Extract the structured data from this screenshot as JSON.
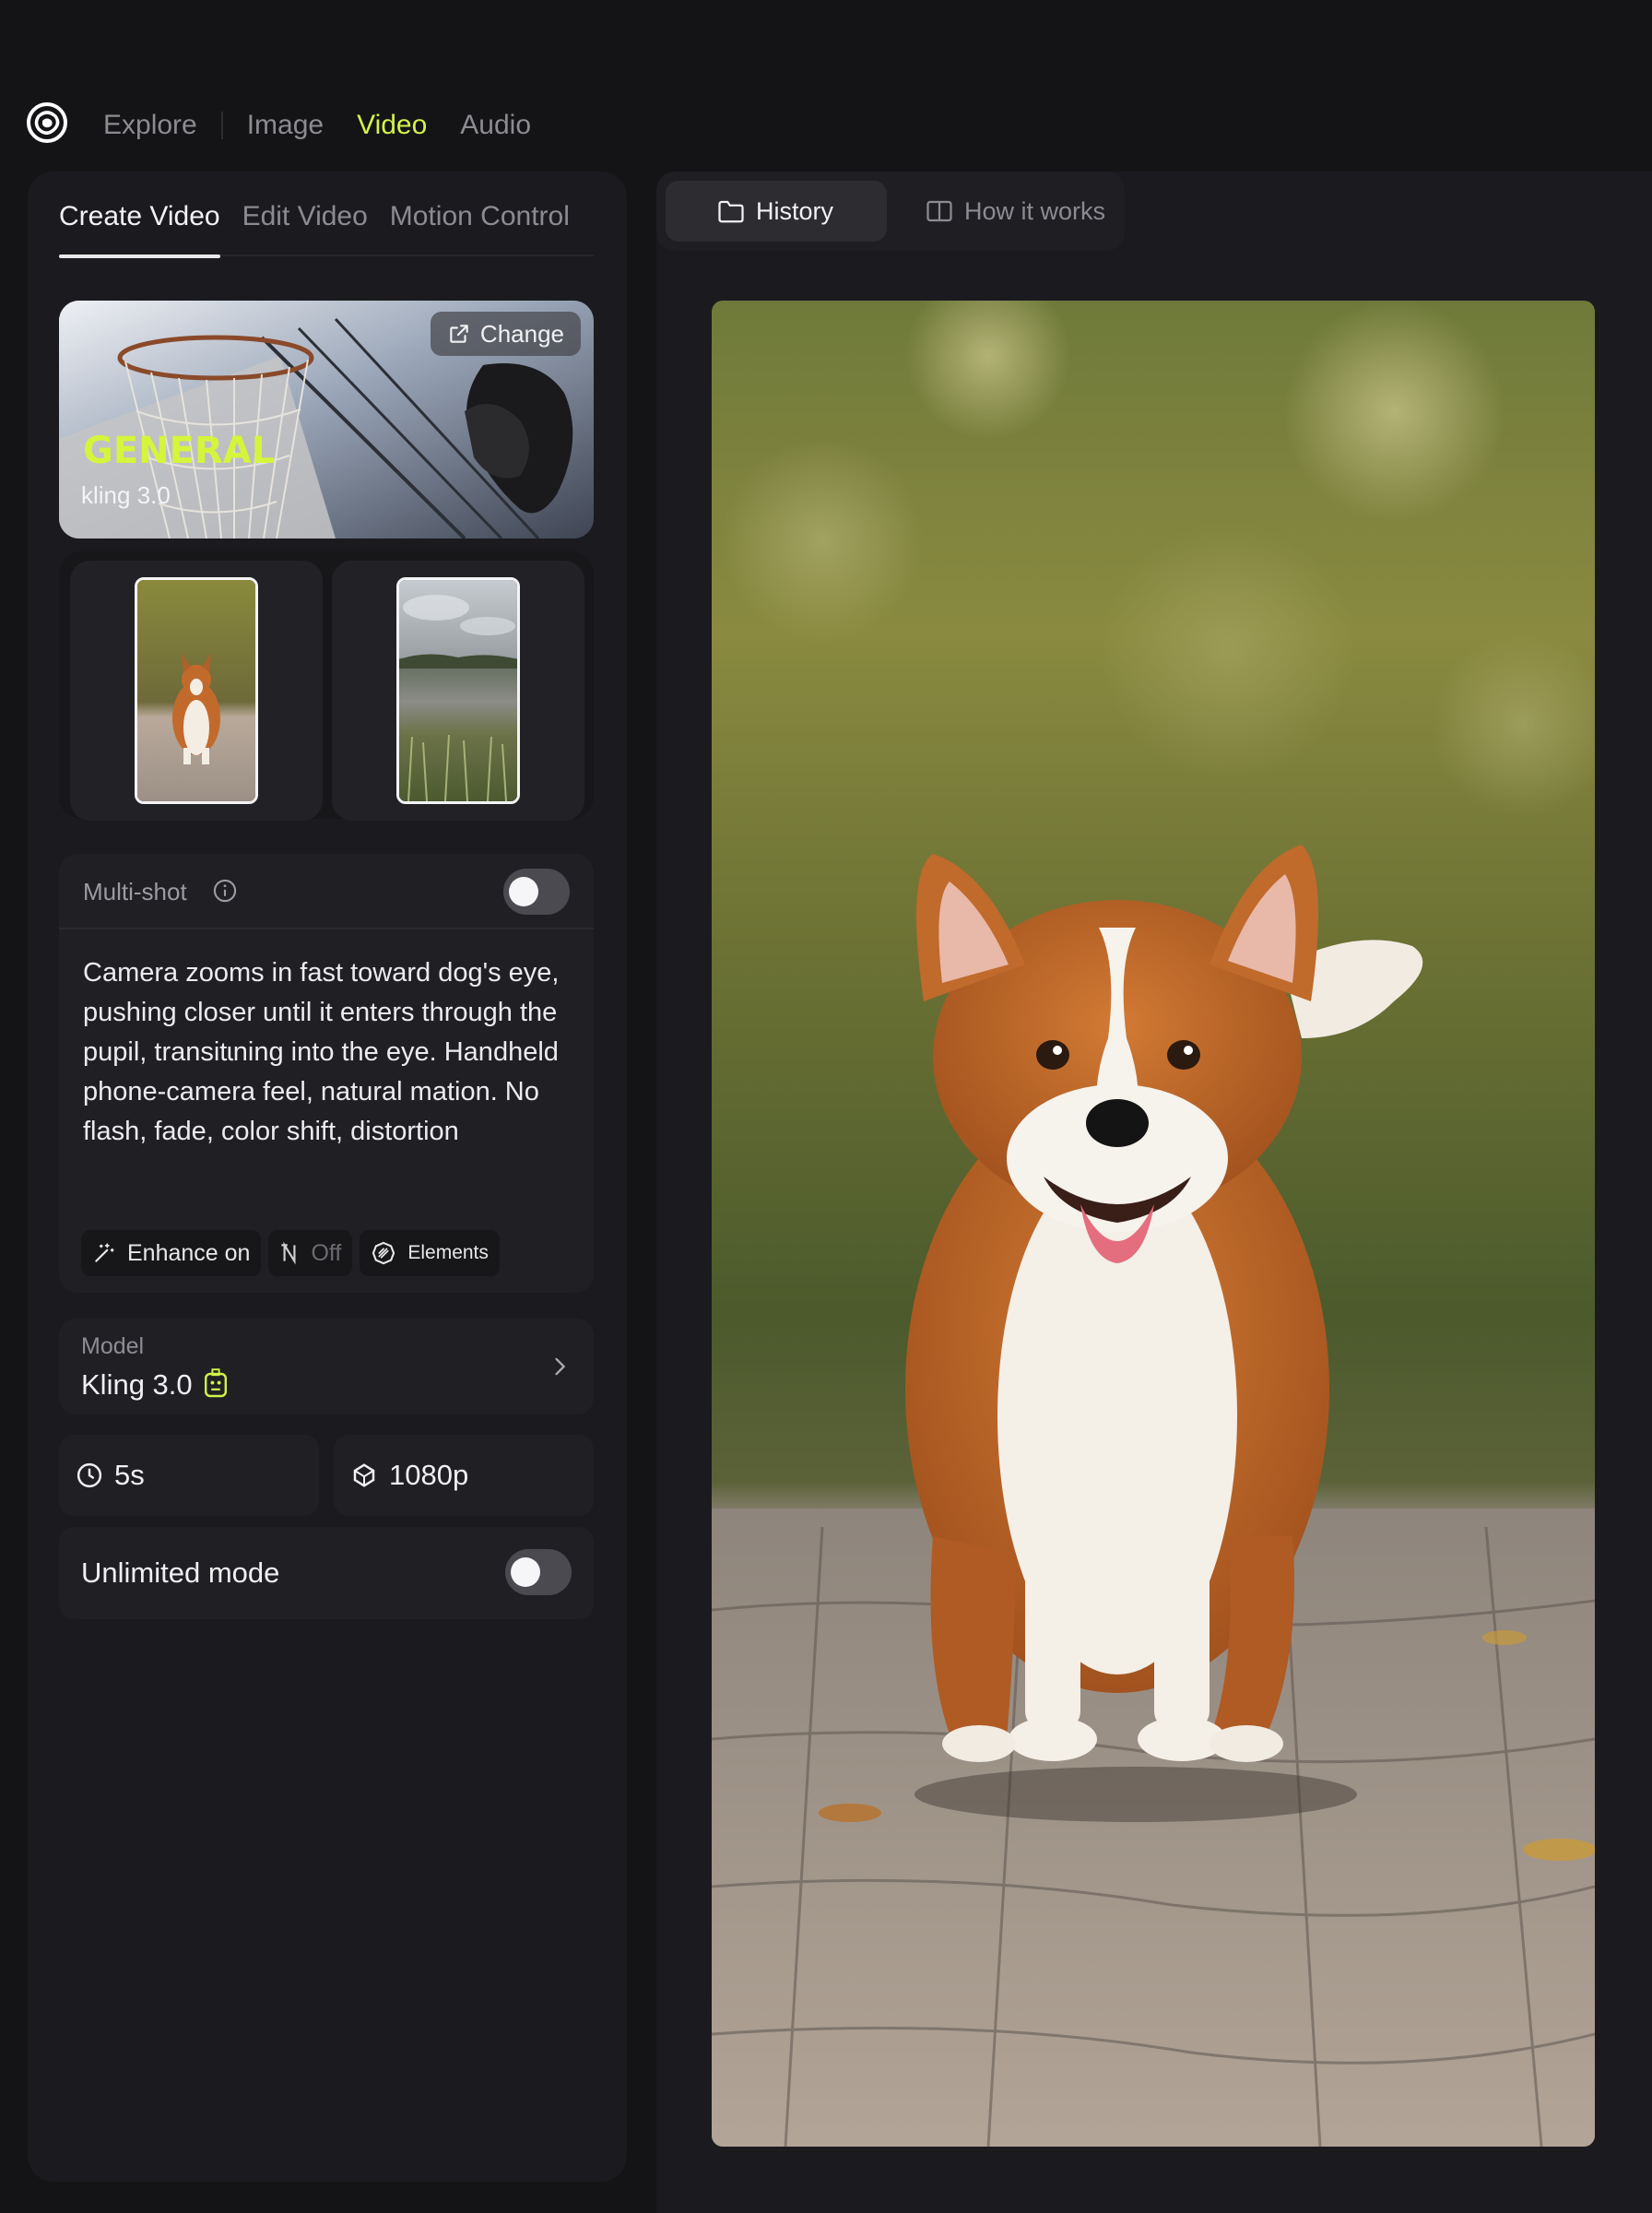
{
  "nav": {
    "items": [
      {
        "label": "Explore",
        "active": false
      },
      {
        "label": "Image",
        "active": false
      },
      {
        "label": "Video",
        "active": true
      },
      {
        "label": "Audio",
        "active": false
      }
    ]
  },
  "left": {
    "tabs": [
      {
        "label": "Create Video",
        "active": true
      },
      {
        "label": "Edit Video",
        "active": false
      },
      {
        "label": "Motion Control",
        "active": false
      }
    ],
    "preset": {
      "change_label": "Change",
      "title": "GENERAL",
      "subtitle": "kling 3.0"
    },
    "multishot": {
      "label": "Multi-shot",
      "enabled": false
    },
    "prompt": "Camera zooms in fast toward dog's eye, pushing closer until it enters through the pupil, transitɩning into the eye. Handheld phone-camera feel, natural mation. No flash, fade, color shift, distortion",
    "chips": {
      "enhance": "Enhance on",
      "off": "Off",
      "elements": "Elements"
    },
    "model": {
      "label": "Model",
      "value": "Kling 3.0"
    },
    "duration": "5s",
    "resolution": "1080p",
    "unlimited": {
      "label": "Unlimited mode",
      "enabled": false
    }
  },
  "right": {
    "tabs": {
      "history": "History",
      "how": "How it works"
    }
  },
  "colors": {
    "accent": "#d2f24a",
    "background": "#141416",
    "panel": "#1b1b1f",
    "card": "#202024"
  }
}
